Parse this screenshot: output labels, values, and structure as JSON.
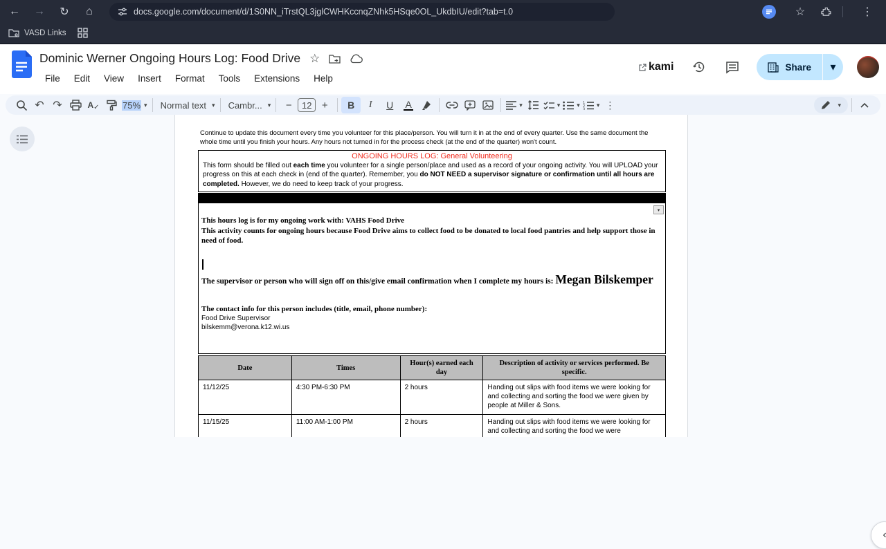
{
  "browser": {
    "url": "docs.google.com/document/d/1S0NN_iTrstQL3jglCWHKccnqZNhk5HSqe0OL_UkdbIU/edit?tab=t.0",
    "back": "←",
    "forward": "→",
    "reload": "↻",
    "home": "⌂",
    "star": "☆",
    "menu_dots": "⋮",
    "bookmark_label": "VASD Links"
  },
  "header": {
    "title": "Dominic Werner Ongoing Hours Log: Food Drive",
    "star": "☆",
    "menus": [
      "File",
      "Edit",
      "View",
      "Insert",
      "Format",
      "Tools",
      "Extensions",
      "Help"
    ],
    "kami_label": "kami",
    "share_label": "Share",
    "share_caret": "▾"
  },
  "toolbar": {
    "undo": "↶",
    "redo": "↷",
    "spell_a": "A",
    "spell_check": "✓",
    "zoom": "75%",
    "caret": "▾",
    "styles": "Normal text",
    "font": "Cambr...",
    "minus": "−",
    "font_size": "12",
    "plus": "+",
    "bold": "B",
    "italic": "I",
    "underline": "U",
    "text_color": "A",
    "more_dots": "⋮",
    "overflow_dots": "⋮"
  },
  "doc": {
    "intro": "Continue to update this document every time you volunteer for this place/person. You will turn it in at the end of every quarter. Use the same document the whole time until you finish your hours. Any hours not turned in for the process check (at the end of the quarter) won't count.",
    "box": {
      "title": "ONGOING HOURS LOG: General Volunteering",
      "seg1": "This form should be filled out ",
      "seg2": "each time",
      "seg3": " you volunteer for a single person/place and used as a record of your ongoing activity. You will UPLOAD your progress on this at each check in (end of the quarter). Remember, you ",
      "seg4": "do NOT NEED a supervisor signature or confirmation until all hours are completed.",
      "seg5": " However, we do need to keep track of your progress."
    },
    "cell_menu_caret": "▾",
    "work": {
      "line1": "This hours log is for my ongoing work with: VAHS Food Drive",
      "line2": "This activity counts for ongoing hours because Food Drive aims to collect food to be donated to local food pantries and help support those in need of food."
    },
    "supervisor": {
      "lead": "The supervisor or person who will sign off on this/give email confirmation when I complete my hours is: ",
      "name": "Megan Bilskemper"
    },
    "contact": {
      "heading": "The contact info for this person includes (title, email, phone number):",
      "title_line": "Food Drive Supervisor",
      "email": "bilskemm@verona.k12.wi.us"
    },
    "table": {
      "headers": [
        "Date",
        "Times",
        "Hour(s) earned each day",
        "Description of activity or services performed. Be specific."
      ],
      "rows": [
        {
          "date": "11/12/25",
          "times": "4:30 PM-6:30 PM",
          "hours": "2 hours",
          "desc": "Handing out slips with food items we were looking for and collecting and sorting the food we were given by people at Miller & Sons."
        },
        {
          "date": "11/15/25",
          "times": "11:00 AM-1:00 PM",
          "hours": "2 hours",
          "desc": "Handing out slips with food items we were looking for and collecting and sorting the food we were"
        }
      ]
    }
  },
  "misc": {
    "panel_chevron": "‹"
  },
  "colors": {
    "accent_red": "#f02b1d",
    "share_bg": "#c2e7ff",
    "table_header_bg": "#bdbdbd",
    "toolbar_bg": "#edf2fa",
    "chrome_bg": "#262b38"
  }
}
